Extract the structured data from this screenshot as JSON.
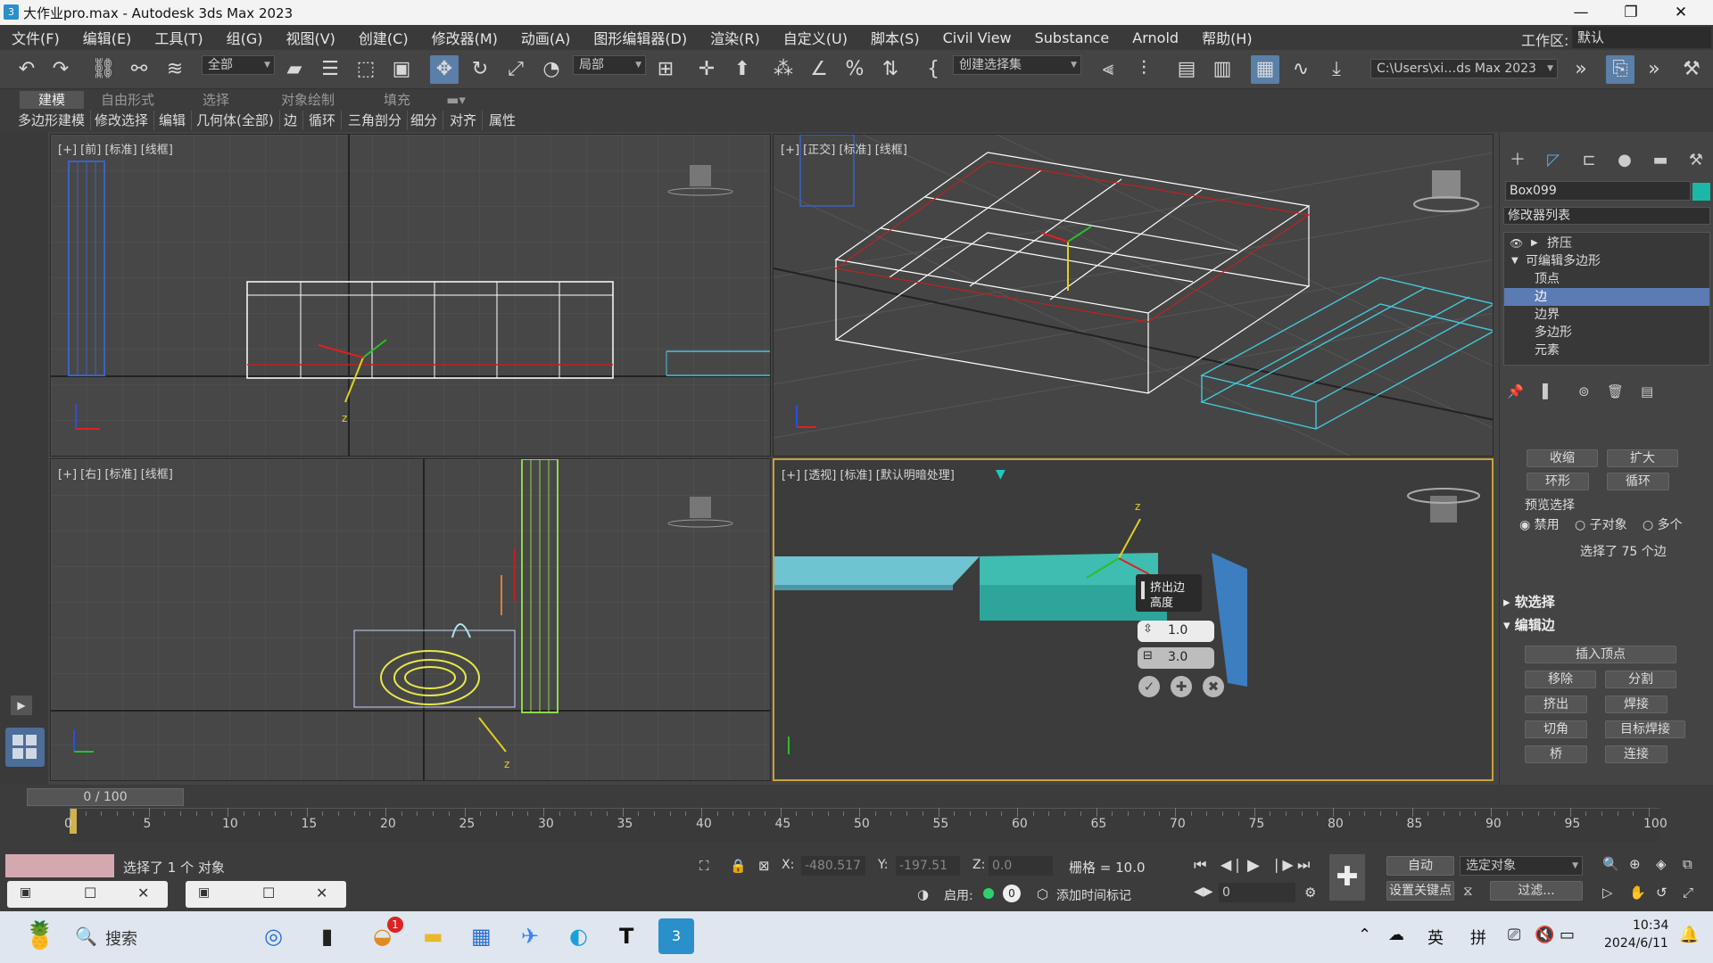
{
  "window": {
    "title": "大作业pro.max - Autodesk 3ds Max 2023"
  },
  "menu": {
    "items": [
      "文件(F)",
      "编辑(E)",
      "工具(T)",
      "组(G)",
      "视图(V)",
      "创建(C)",
      "修改器(M)",
      "动画(A)",
      "图形编辑器(D)",
      "渲染(R)",
      "自定义(U)",
      "脚本(S)",
      "Civil View",
      "Substance",
      "Arnold",
      "帮助(H)"
    ],
    "workspace_label": "工作区:",
    "workspace_value": "默认"
  },
  "toolbar": {
    "selection_filter": "全部",
    "ref_coord": "局部",
    "named_selection": "创建选择集",
    "project_path": "C:\\Users\\xi…ds Max 2023"
  },
  "ribbon": {
    "tabs": [
      "建模",
      "自由形式",
      "选择",
      "对象绘制",
      "填充"
    ],
    "sub": [
      "多边形建模",
      "修改选择",
      "编辑",
      "几何体(全部)",
      "边",
      "循环",
      "三角剖分",
      "细分",
      "对齐",
      "属性"
    ]
  },
  "viewports": {
    "front": "[+] [前] [标准] [线框]",
    "ortho": "[+] [正交] [标准] [线框]",
    "right": "[+] [右] [标准] [线框]",
    "persp": "[+] [透视] [标准] [默认明暗处理]",
    "persp_caddy": {
      "title1": "挤出边",
      "title2": "高度",
      "height": "1.0",
      "width": "3.0"
    }
  },
  "panel": {
    "object_name": "Box099",
    "object_color": "#1ab8a7",
    "modifier_list": "修改器列表",
    "stack": [
      "挤压",
      "可编辑多边形",
      "顶点",
      "边",
      "边界",
      "多边形",
      "元素"
    ],
    "selected_stack": "边",
    "btn_shrink": "收缩",
    "btn_grow": "扩大",
    "btn_ring": "环形",
    "btn_loop": "循环",
    "preview_select": "预览选择",
    "radio_off": "禁用",
    "radio_sub": "子对象",
    "radio_multi": "多个",
    "selected_info": "选择了 75 个边",
    "soft_select": "软选择",
    "edit_edges": "编辑边",
    "insert_vertex": "插入顶点",
    "remove": "移除",
    "split": "分割",
    "extrude": "挤出",
    "weld": "焊接",
    "chamfer": "切角",
    "target_weld": "目标焊接",
    "bridge": "桥",
    "connect": "连接"
  },
  "timeline": {
    "frame": "0 / 100",
    "ticks": [
      "0",
      "5",
      "10",
      "15",
      "20",
      "25",
      "30",
      "35",
      "40",
      "45",
      "50",
      "55",
      "60",
      "65",
      "70",
      "75",
      "80",
      "85",
      "90",
      "95",
      "100"
    ]
  },
  "status": {
    "selected": "选择了 1 个 对象",
    "x_label": "X:",
    "x_value": "-480.517",
    "y_label": "Y:",
    "y_value": "-197.51",
    "z_label": "Z:",
    "z_value": "0.0",
    "grid": "栅格 = 10.0",
    "enable": "启用:",
    "add_tag": "添加时间标记",
    "auto": "自动",
    "selected_obj": "选定对象",
    "set_key": "设置关键点",
    "filter": "过滤...",
    "frame_input": "0"
  },
  "taskbar": {
    "search": "搜索",
    "lang1": "英",
    "lang2": "拼",
    "time": "10:34",
    "date": "2024/6/11",
    "badge": "1"
  }
}
